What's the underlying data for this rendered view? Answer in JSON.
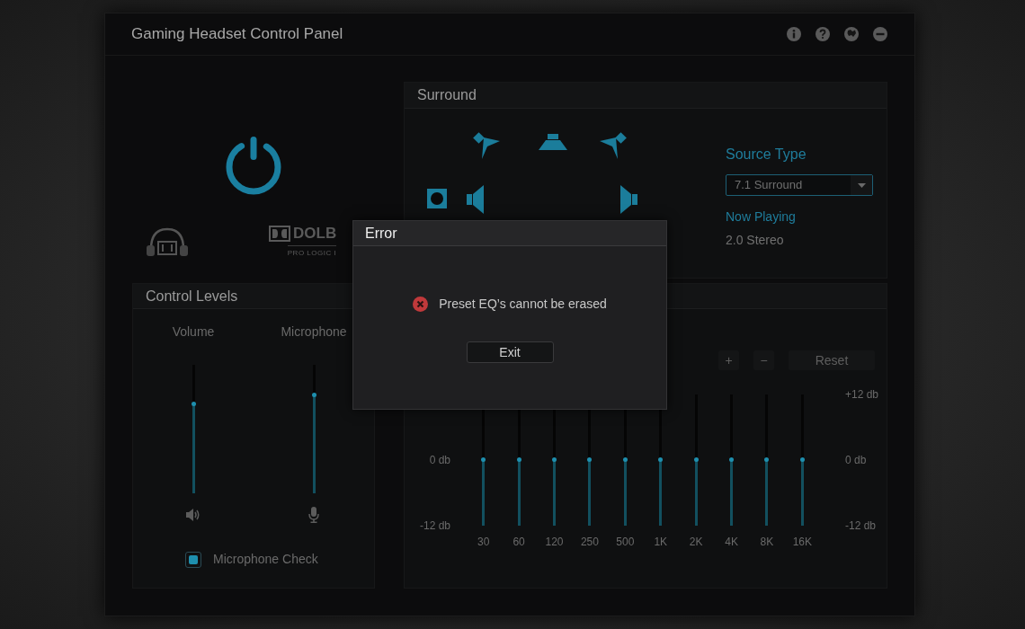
{
  "window": {
    "title": "Gaming Headset Control Panel"
  },
  "logo": {
    "wordmark": "DOLB",
    "subtitle": "PRO LOGIC I"
  },
  "surround": {
    "title": "Surround",
    "source_type_label": "Source Type",
    "source_type": "7.1 Surround",
    "now_playing_label": "Now Playing",
    "now_playing": "2.0 Stereo"
  },
  "control_levels": {
    "title": "Control Levels",
    "sliders": [
      {
        "label": "Volume",
        "kind": "volume",
        "level": 0.69
      },
      {
        "label": "Microphone",
        "kind": "microphone",
        "level": 0.76
      }
    ],
    "microphone_check": {
      "label": "Microphone Check",
      "checked": true
    }
  },
  "equalizer": {
    "buttons": [
      "+",
      "−",
      "Reset"
    ],
    "scale_left": [
      "0 db",
      "-12 db"
    ],
    "scale_right": [
      "+12 db",
      "0 db",
      "-12 db"
    ],
    "bands": [
      {
        "label": "30",
        "level": 0.5
      },
      {
        "label": "60",
        "level": 0.5
      },
      {
        "label": "120",
        "level": 0.5
      },
      {
        "label": "250",
        "level": 0.5
      },
      {
        "label": "500",
        "level": 0.5
      },
      {
        "label": "1K",
        "level": 0.5
      },
      {
        "label": "2K",
        "level": 0.5
      },
      {
        "label": "4K",
        "level": 0.5
      },
      {
        "label": "8K",
        "level": 0.5
      },
      {
        "label": "16K",
        "level": 0.5
      }
    ]
  },
  "dialog": {
    "title": "Error",
    "message": "Preset EQ’s cannot be erased",
    "button": "Exit"
  }
}
